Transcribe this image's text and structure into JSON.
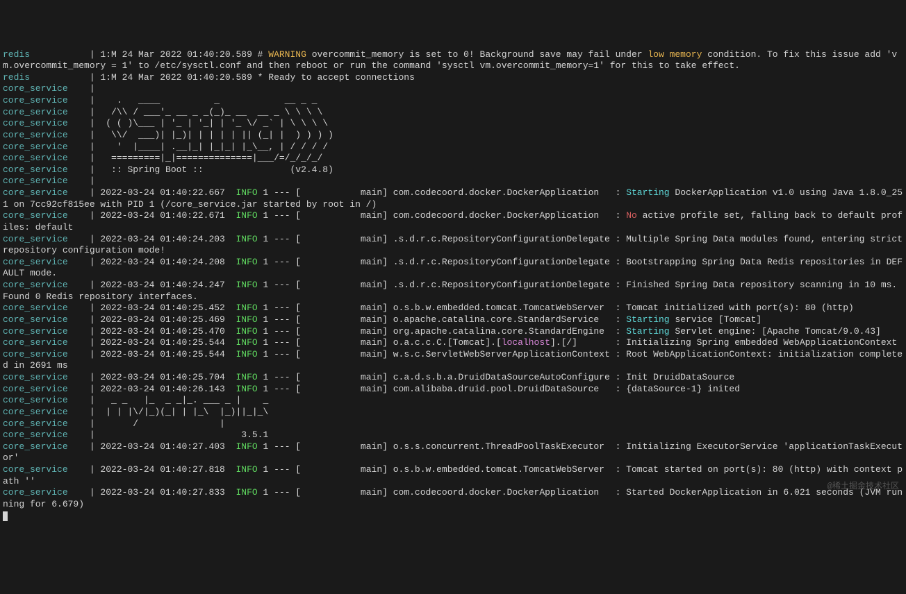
{
  "colors": {
    "service": "#5fb3b3",
    "warning": "#e6b450",
    "info": "#5fd75f",
    "starting": "#5fd7d7",
    "no": "#d75f5f",
    "localhost": "#d787d7"
  },
  "watermark": "@稀土掘金技术社区",
  "spring_banner": {
    "version": "(v2.4.8)",
    "label": ":: Spring Boot ::"
  },
  "mybatis_banner": {
    "version": "3.5.1"
  },
  "redis": {
    "svc": "redis",
    "ts1": "1:M 24 Mar 2022 01:40:20.589",
    "warn_label": "WARNING",
    "warn_msg_a": "overcommit_memory is set to 0! Background save may fail under ",
    "lowmem": "low memory",
    "warn_msg_b": " condition. To fix this issue add 'vm.overcommit_memory = 1' to /etc/sysctl.conf and then reboot or run the command 'sysctl vm.overcommit_memory=1' for this to take effect.",
    "ts2": "1:M 24 Mar 2022 01:40:20.589 * Ready to accept connections"
  },
  "lines": [
    {
      "svc": "core_service",
      "ts": "",
      "body": ""
    },
    {
      "svc": "core_service",
      "ts": "",
      "body": ""
    },
    {
      "svc": "core_service",
      "ts": "",
      "body": ""
    },
    {
      "svc": "core_service",
      "ts": "",
      "body": ""
    },
    {
      "svc": "core_service",
      "ts": "",
      "body": ""
    },
    {
      "svc": "core_service",
      "ts": "",
      "body": ""
    },
    {
      "svc": "core_service",
      "ts": "",
      "body": ""
    },
    {
      "svc": "core_service",
      "ts": "",
      "body": ""
    },
    {
      "svc": "core_service",
      "ts": "",
      "body": ""
    }
  ],
  "log": [
    {
      "svc": "core_service",
      "ts": "2022-03-24 01:40:22.667",
      "lvl": "INFO",
      "thr": "1 --- [           main]",
      "cls": "com.codecoord.docker.DockerApplication   ",
      "sep": ": ",
      "start": "Starting",
      "msg": " DockerApplication v1.0 using Java 1.8.0_251 on 7cc92cf815ee with PID 1 (/core_service.jar started by root in /)"
    },
    {
      "svc": "core_service",
      "ts": "2022-03-24 01:40:22.671",
      "lvl": "INFO",
      "thr": "1 --- [           main]",
      "cls": "com.codecoord.docker.DockerApplication   ",
      "sep": ": ",
      "no": "No",
      "msg": " active profile set, falling back to default profiles: default"
    },
    {
      "svc": "core_service",
      "ts": "2022-03-24 01:40:24.203",
      "lvl": "INFO",
      "thr": "1 --- [           main]",
      "cls": ".s.d.r.c.RepositoryConfigurationDelegate ",
      "sep": ": ",
      "msg": "Multiple Spring Data modules found, entering strict repository configuration mode!"
    },
    {
      "svc": "core_service",
      "ts": "2022-03-24 01:40:24.208",
      "lvl": "INFO",
      "thr": "1 --- [           main]",
      "cls": ".s.d.r.c.RepositoryConfigurationDelegate ",
      "sep": ": ",
      "msg": "Bootstrapping Spring Data Redis repositories in DEFAULT mode."
    },
    {
      "svc": "core_service",
      "ts": "2022-03-24 01:40:24.247",
      "lvl": "INFO",
      "thr": "1 --- [           main]",
      "cls": ".s.d.r.c.RepositoryConfigurationDelegate ",
      "sep": ": ",
      "msg": "Finished Spring Data repository scanning in 10 ms. Found 0 Redis repository interfaces."
    },
    {
      "svc": "core_service",
      "ts": "2022-03-24 01:40:25.452",
      "lvl": "INFO",
      "thr": "1 --- [           main]",
      "cls": "o.s.b.w.embedded.tomcat.TomcatWebServer  ",
      "sep": ": ",
      "msg": "Tomcat initialized with port(s): 80 (http)"
    },
    {
      "svc": "core_service",
      "ts": "2022-03-24 01:40:25.469",
      "lvl": "INFO",
      "thr": "1 --- [           main]",
      "cls": "o.apache.catalina.core.StandardService   ",
      "sep": ": ",
      "start": "Starting",
      "msg": " service [Tomcat]"
    },
    {
      "svc": "core_service",
      "ts": "2022-03-24 01:40:25.470",
      "lvl": "INFO",
      "thr": "1 --- [           main]",
      "cls": "org.apache.catalina.core.StandardEngine  ",
      "sep": ": ",
      "start": "Starting",
      "msg": " Servlet engine: [Apache Tomcat/9.0.43]"
    },
    {
      "svc": "core_service",
      "ts": "2022-03-24 01:40:25.544",
      "lvl": "INFO",
      "thr": "1 --- [           main]",
      "cls": "o.a.c.c.C.[Tomcat].[",
      "localhost": "localhost",
      "cls2": "].[/]       ",
      "sep": ": ",
      "msg": "Initializing Spring embedded WebApplicationContext"
    },
    {
      "svc": "core_service",
      "ts": "2022-03-24 01:40:25.544",
      "lvl": "INFO",
      "thr": "1 --- [           main]",
      "cls": "w.s.c.ServletWebServerApplicationContext ",
      "sep": ": ",
      "msg": "Root WebApplicationContext: initialization completed in 2691 ms"
    },
    {
      "svc": "core_service",
      "ts": "2022-03-24 01:40:25.704",
      "lvl": "INFO",
      "thr": "1 --- [           main]",
      "cls": "c.a.d.s.b.a.DruidDataSourceAutoConfigure ",
      "sep": ": ",
      "msg": "Init DruidDataSource"
    },
    {
      "svc": "core_service",
      "ts": "2022-03-24 01:40:26.143",
      "lvl": "INFO",
      "thr": "1 --- [           main]",
      "cls": "com.alibaba.druid.pool.DruidDataSource   ",
      "sep": ": ",
      "msg": "{dataSource-1} inited"
    }
  ],
  "mybatis_lines": [
    {
      "svc": "core_service"
    },
    {
      "svc": "core_service"
    },
    {
      "svc": "core_service"
    },
    {
      "svc": "core_service"
    }
  ],
  "log2": [
    {
      "svc": "core_service",
      "ts": "2022-03-24 01:40:27.403",
      "lvl": "INFO",
      "thr": "1 --- [           main]",
      "cls": "o.s.s.concurrent.ThreadPoolTaskExecutor  ",
      "sep": ": ",
      "msg": "Initializing ExecutorService 'applicationTaskExecutor'"
    },
    {
      "svc": "core_service",
      "ts": "2022-03-24 01:40:27.818",
      "lvl": "INFO",
      "thr": "1 --- [           main]",
      "cls": "o.s.b.w.embedded.tomcat.TomcatWebServer  ",
      "sep": ": ",
      "msg": "Tomcat started on port(s): 80 (http) with context path ''"
    },
    {
      "svc": "core_service",
      "ts": "2022-03-24 01:40:27.833",
      "lvl": "INFO",
      "thr": "1 --- [           main]",
      "cls": "com.codecoord.docker.DockerApplication   ",
      "sep": ": ",
      "msg": "Started DockerApplication in 6.021 seconds (JVM running for 6.679)"
    }
  ]
}
